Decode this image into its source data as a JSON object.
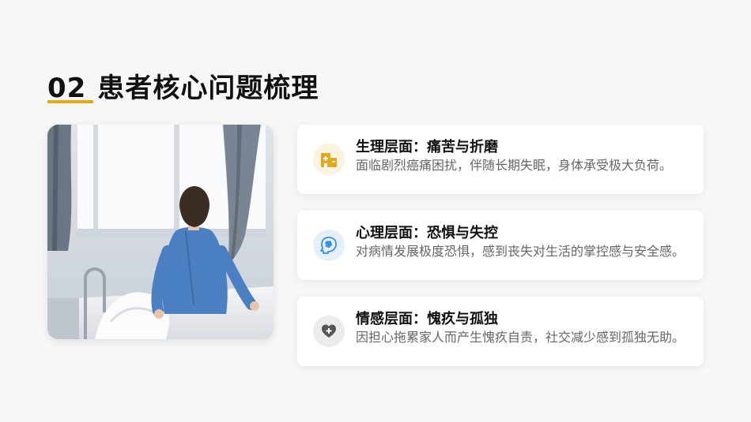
{
  "page": {
    "number": "02",
    "title": "患者核心问题梳理",
    "accent_color": "#e0a91f"
  },
  "photo": {
    "description_icon": "patient-sitting-on-hospital-bed-photo"
  },
  "cards": [
    {
      "icon": "hospital-building-icon",
      "icon_color": "#e0a91f",
      "heading": "生理层面：痛苦与折磨",
      "description": "面临剧烈癌痛困扰，伴随长期失眠，身体承受极大负荷。"
    },
    {
      "icon": "head-brain-icon",
      "icon_color": "#3a8ee6",
      "heading": "心理层面：恐惧与失控",
      "description": "对病情发展极度恐惧，感到丧失对生活的掌控感与安全感。"
    },
    {
      "icon": "heart-plus-icon",
      "icon_color": "#555555",
      "heading": "情感层面：愧疚与孤独",
      "description": "因担心拖累家人而产生愧疚自责，社交减少感到孤独无助。"
    }
  ]
}
